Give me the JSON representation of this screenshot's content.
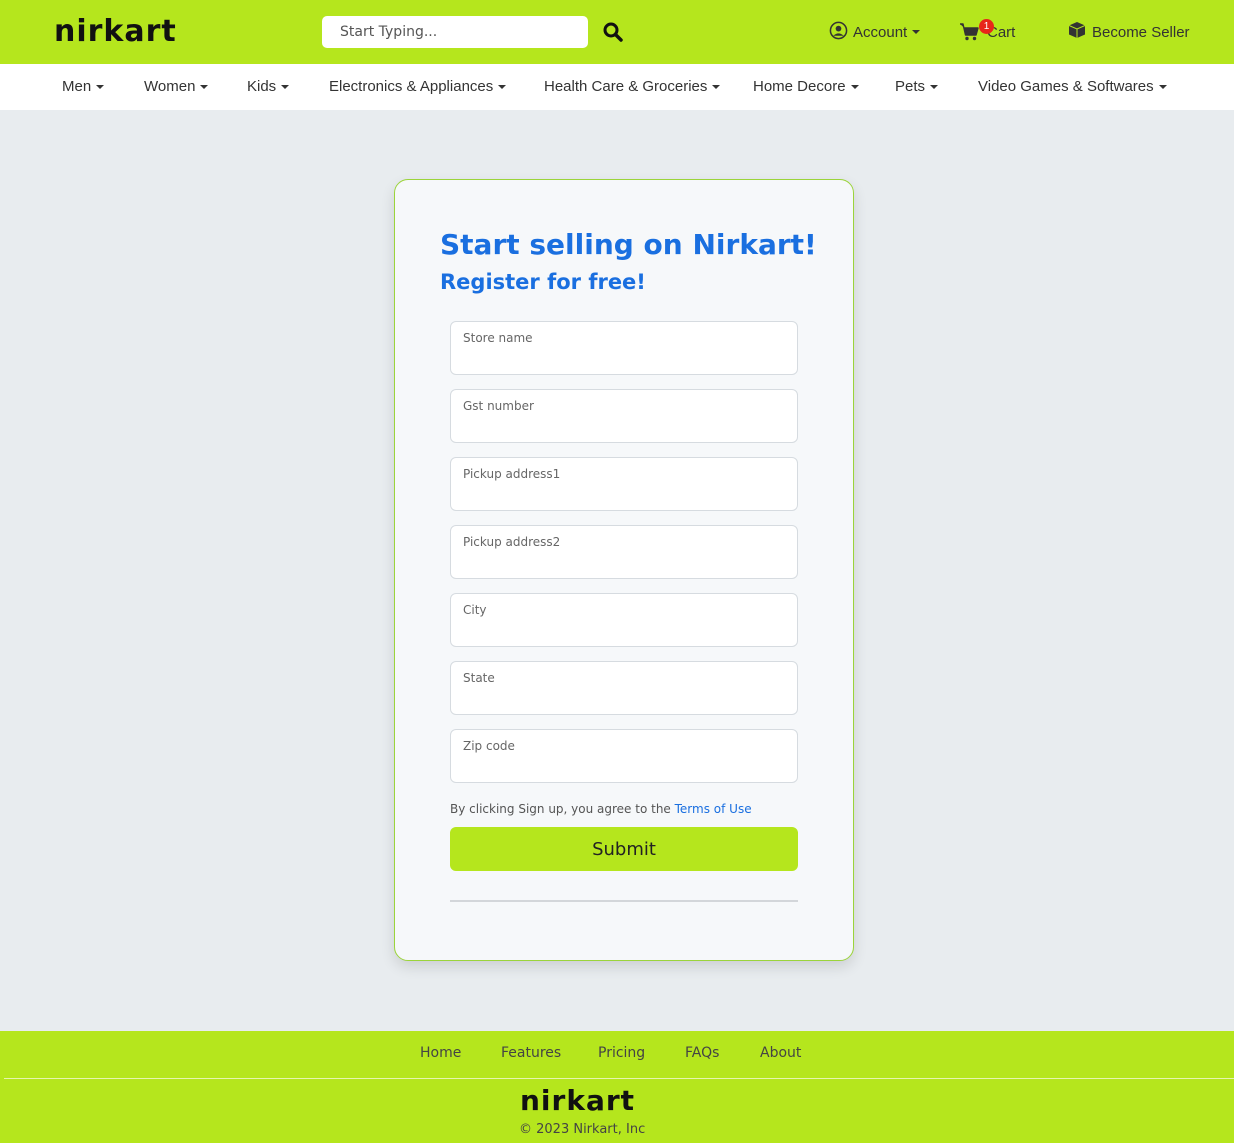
{
  "header": {
    "logo": "nirkart",
    "search_placeholder": "Start Typing...",
    "account_label": "Account",
    "cart_label": "Cart",
    "cart_count": "1",
    "seller_label": "Become Seller"
  },
  "categories": [
    "Men",
    "Women",
    "Kids",
    "Electronics & Appliances",
    "Health Care & Groceries",
    "Home Decore",
    "Pets",
    "Video Games & Softwares"
  ],
  "form": {
    "title": "Start selling on Nirkart!",
    "subtitle": "Register for free!",
    "fields": [
      {
        "label": "Store name",
        "value": ""
      },
      {
        "label": "Gst number",
        "value": ""
      },
      {
        "label": "Pickup address1",
        "value": ""
      },
      {
        "label": "Pickup address2",
        "value": ""
      },
      {
        "label": "City",
        "value": ""
      },
      {
        "label": "State",
        "value": ""
      },
      {
        "label": "Zip code",
        "value": ""
      }
    ],
    "terms_text": "By clicking Sign up, you agree to the ",
    "terms_link": "Terms of Use",
    "submit_label": "Submit"
  },
  "footer": {
    "links": [
      "Home",
      "Features",
      "Pricing",
      "FAQs",
      "About"
    ],
    "logo": "nirkart",
    "copyright": "© 2023 Nirkart, Inc"
  },
  "colors": {
    "brand": "#b5e61d",
    "accent": "#1a6fe0",
    "badge": "#e8261a"
  }
}
